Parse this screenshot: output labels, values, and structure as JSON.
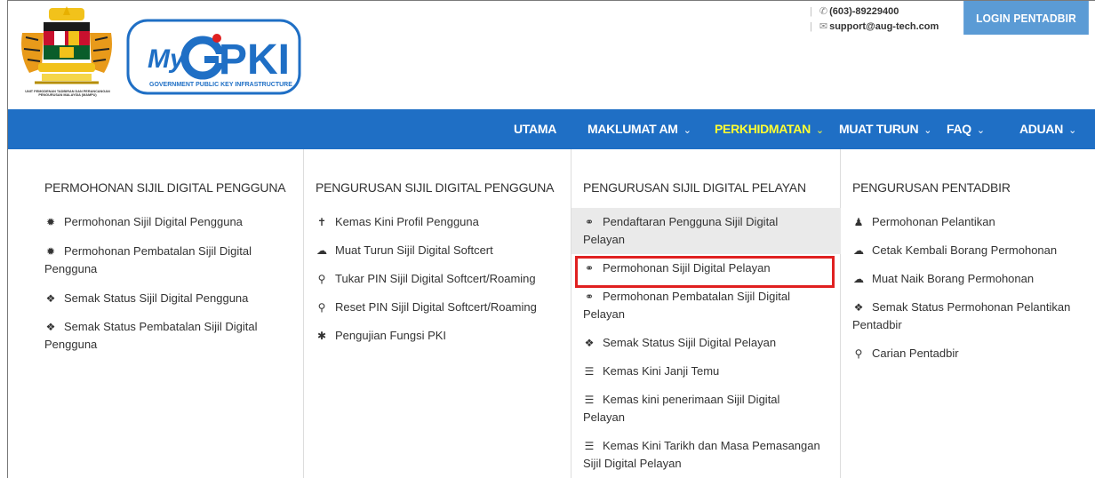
{
  "header": {
    "agency_caption": "UNIT PEMODENAN TADBIRAN DAN PERANCANGAN PENGURUSAN MALAYSIA (MAMPU)",
    "logo_text": "MyGPKI",
    "logo_subtitle": "GOVERNMENT PUBLIC KEY INFRASTRUCTURE",
    "phone": "(603)-89229400",
    "email": "support@aug-tech.com",
    "login_label": "LOGIN PENTADBIR"
  },
  "nav": {
    "items": [
      {
        "label": "UTAMA",
        "dropdown": false
      },
      {
        "label": "MAKLUMAT AM",
        "dropdown": true
      },
      {
        "label": "PERKHIDMATAN",
        "dropdown": true,
        "active": true
      },
      {
        "label": "MUAT TURUN",
        "dropdown": true
      },
      {
        "label": "FAQ",
        "dropdown": true
      },
      {
        "label": "ADUAN",
        "dropdown": true
      }
    ],
    "active_color": "#ffff33",
    "bar_color": "#1f6fc5"
  },
  "mega_menu": {
    "columns": [
      {
        "title": "PERMOHONAN SIJIL DIGITAL PENGGUNA",
        "items": [
          {
            "icon": "gear-icon",
            "label_lines": [
              "Permohonan Sijil Digital Pengguna"
            ]
          },
          {
            "icon": "gear-icon",
            "label_lines": [
              "Permohonan Pembatalan Sijil Digital",
              "Pengguna"
            ]
          },
          {
            "icon": "info-icon",
            "label_lines": [
              "Semak Status Sijil Digital Pengguna"
            ]
          },
          {
            "icon": "info-icon",
            "label_lines": [
              "Semak Status Pembatalan Sijil Digital",
              "Pengguna"
            ]
          }
        ]
      },
      {
        "title": "PENGURUSAN SIJIL DIGITAL PENGGUNA",
        "items": [
          {
            "icon": "user-icon",
            "label_lines": [
              "Kemas Kini Profil Pengguna"
            ]
          },
          {
            "icon": "cloud-download-icon",
            "label_lines": [
              "Muat Turun Sijil Digital Softcert"
            ]
          },
          {
            "icon": "key-icon",
            "label_lines": [
              "Tukar PIN Sijil Digital Softcert/Roaming"
            ]
          },
          {
            "icon": "key-icon",
            "label_lines": [
              "Reset PIN Sijil Digital Softcert/Roaming"
            ]
          },
          {
            "icon": "asterisk-icon",
            "label_lines": [
              "Pengujian Fungsi PKI"
            ]
          }
        ]
      },
      {
        "title": "PENGURUSAN SIJIL DIGITAL PELAYAN",
        "items": [
          {
            "icon": "lock-circle-icon",
            "label_lines": [
              "Pendaftaran Pengguna Sijil Digital",
              "Pelayan"
            ],
            "hover": true
          },
          {
            "icon": "lock-circle-icon",
            "label_lines": [
              "Permohonan Sijil Digital Pelayan"
            ],
            "highlighted": true
          },
          {
            "icon": "lock-circle-icon",
            "label_lines": [
              "Permohonan Pembatalan Sijil Digital",
              "Pelayan"
            ]
          },
          {
            "icon": "info-icon",
            "label_lines": [
              "Semak Status Sijil Digital Pelayan"
            ]
          },
          {
            "icon": "list-icon",
            "label_lines": [
              "Kemas Kini Janji Temu"
            ]
          },
          {
            "icon": "list-icon",
            "label_lines": [
              "Kemas kini penerimaan Sijil Digital",
              "Pelayan"
            ]
          },
          {
            "icon": "list-icon",
            "label_lines": [
              "Kemas Kini Tarikh dan Masa Pemasangan",
              "Sijil Digital Pelayan"
            ]
          }
        ]
      },
      {
        "title": "PENGURUSAN PENTADBIR",
        "items": [
          {
            "icon": "user-icon",
            "label_lines": [
              "Permohonan Pelantikan"
            ]
          },
          {
            "icon": "cloud-icon",
            "label_lines": [
              "Cetak Kembali Borang Permohonan"
            ]
          },
          {
            "icon": "cloud-upload-icon",
            "label_lines": [
              "Muat Naik Borang Permohonan"
            ]
          },
          {
            "icon": "info-icon",
            "label_lines": [
              "Semak Status Permohonan Pelantikan",
              "Pentadbir"
            ]
          },
          {
            "icon": "search-icon",
            "label_lines": [
              "Carian Pentadbir"
            ]
          }
        ]
      }
    ],
    "highlight_color": "#e02020"
  }
}
